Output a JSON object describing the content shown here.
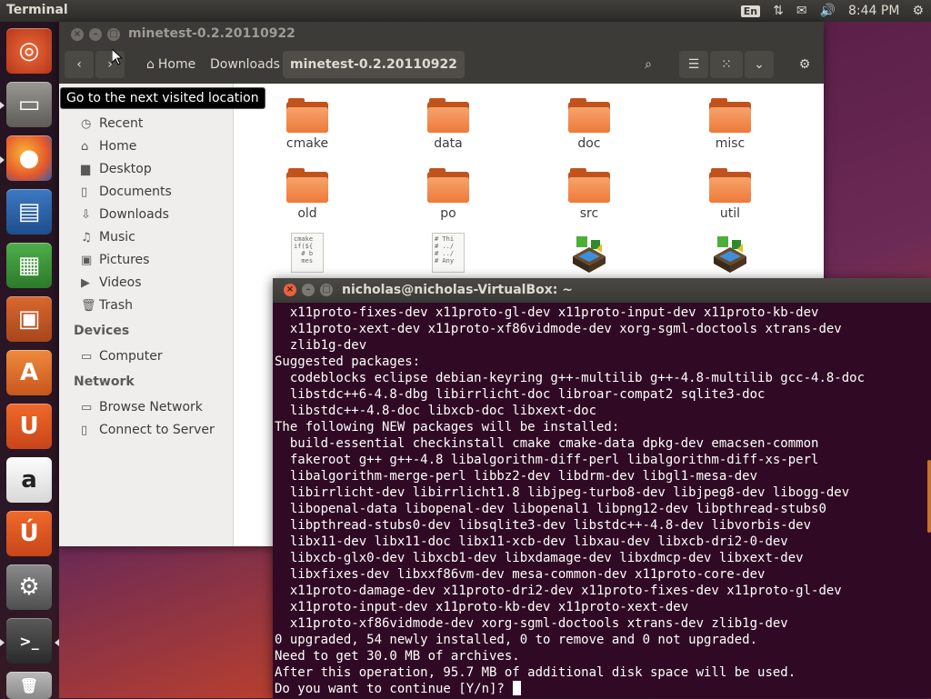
{
  "topbar": {
    "title": "Terminal",
    "keyboard": "En",
    "clock": "8:44 PM"
  },
  "launcher": {
    "items": [
      {
        "name": "dash-home-icon"
      },
      {
        "name": "files-icon"
      },
      {
        "name": "firefox-icon"
      },
      {
        "name": "libreoffice-writer-icon"
      },
      {
        "name": "libreoffice-calc-icon"
      },
      {
        "name": "libreoffice-impress-icon"
      },
      {
        "name": "software-center-icon"
      },
      {
        "name": "ubuntu-one-icon"
      },
      {
        "name": "amazon-icon"
      },
      {
        "name": "ubuntu-one-music-icon"
      },
      {
        "name": "system-settings-icon"
      },
      {
        "name": "terminal-icon"
      },
      {
        "name": "trash-icon"
      }
    ]
  },
  "nautilus": {
    "title": "minetest-0.2.20110922",
    "breadcrumbs": {
      "home": "Home",
      "downloads": "Downloads",
      "current": "minetest-0.2.20110922"
    },
    "tooltip": "Go to the next visited location",
    "sidebar": {
      "places": [
        "Recent",
        "Home",
        "Desktop",
        "Documents",
        "Downloads",
        "Music",
        "Pictures",
        "Videos",
        "Trash"
      ],
      "devices_header": "Devices",
      "devices": [
        "Computer"
      ],
      "network_header": "Network",
      "network": [
        "Browse Network",
        "Connect to Server"
      ]
    },
    "files": [
      {
        "label": "cmake",
        "kind": "folder"
      },
      {
        "label": "data",
        "kind": "folder"
      },
      {
        "label": "doc",
        "kind": "folder"
      },
      {
        "label": "misc",
        "kind": "folder"
      },
      {
        "label": "old",
        "kind": "folder"
      },
      {
        "label": "po",
        "kind": "folder"
      },
      {
        "label": "src",
        "kind": "folder"
      },
      {
        "label": "util",
        "kind": "folder"
      }
    ],
    "textfile1": "cmake\nif(${\n  # b\n  mes",
    "textfile2": "# Thi\n# ../\n# ../\n# Any"
  },
  "terminal": {
    "title": "nicholas@nicholas-VirtualBox: ~",
    "lines": [
      "  x11proto-fixes-dev x11proto-gl-dev x11proto-input-dev x11proto-kb-dev",
      "  x11proto-xext-dev x11proto-xf86vidmode-dev xorg-sgml-doctools xtrans-dev",
      "  zlib1g-dev",
      "Suggested packages:",
      "  codeblocks eclipse debian-keyring g++-multilib g++-4.8-multilib gcc-4.8-doc",
      "  libstdc++6-4.8-dbg libirrlicht-doc libroar-compat2 sqlite3-doc",
      "  libstdc++-4.8-doc libxcb-doc libxext-doc",
      "The following NEW packages will be installed:",
      "  build-essential checkinstall cmake cmake-data dpkg-dev emacsen-common",
      "  fakeroot g++ g++-4.8 libalgorithm-diff-perl libalgorithm-diff-xs-perl",
      "  libalgorithm-merge-perl libbz2-dev libdrm-dev libgl1-mesa-dev",
      "  libirrlicht-dev libirrlicht1.8 libjpeg-turbo8-dev libjpeg8-dev libogg-dev",
      "  libopenal-data libopenal-dev libopenal1 libpng12-dev libpthread-stubs0",
      "  libpthread-stubs0-dev libsqlite3-dev libstdc++-4.8-dev libvorbis-dev",
      "  libx11-dev libx11-doc libx11-xcb-dev libxau-dev libxcb-dri2-0-dev",
      "  libxcb-glx0-dev libxcb1-dev libxdamage-dev libxdmcp-dev libxext-dev",
      "  libxfixes-dev libxxf86vm-dev mesa-common-dev x11proto-core-dev",
      "  x11proto-damage-dev x11proto-dri2-dev x11proto-fixes-dev x11proto-gl-dev",
      "  x11proto-input-dev x11proto-kb-dev x11proto-xext-dev",
      "  x11proto-xf86vidmode-dev xorg-sgml-doctools xtrans-dev zlib1g-dev",
      "0 upgraded, 54 newly installed, 0 to remove and 0 not upgraded.",
      "Need to get 30.0 MB of archives.",
      "After this operation, 95.7 MB of additional disk space will be used.",
      "Do you want to continue [Y/n]?"
    ]
  }
}
